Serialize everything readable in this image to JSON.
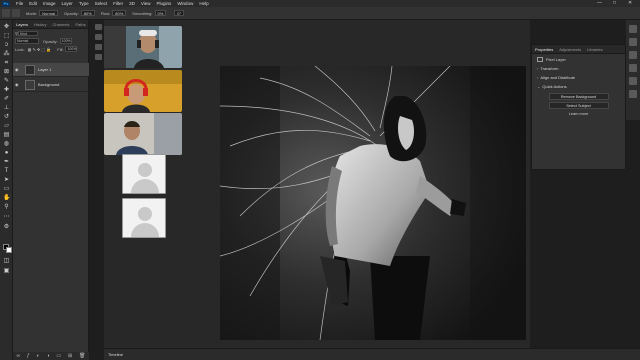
{
  "menubar": {
    "logo": "Ps",
    "items": [
      "File",
      "Edit",
      "Image",
      "Layer",
      "Type",
      "Select",
      "Filter",
      "3D",
      "View",
      "Plugins",
      "Window",
      "Help"
    ],
    "min": "—",
    "max": "□",
    "close": "✕"
  },
  "options": {
    "mode_label": "Mode:",
    "mode_value": "Normal",
    "opacity_label": "Opacity:",
    "opacity_value": "80%",
    "flow_label": "Flow:",
    "flow_value": "80%",
    "smoothing_label": "Smoothing:",
    "smoothing_value": "0%",
    "angle_value": "0°"
  },
  "layers": {
    "tabs": [
      "Layers",
      "History",
      "Channels",
      "Paths"
    ],
    "kind_label": "Kind",
    "blend_mode": "Normal",
    "opacity_label": "Opacity:",
    "opacity_value": "100%",
    "lock_label": "Lock:",
    "fill_label": "Fill:",
    "fill_value": "100%",
    "items": [
      {
        "name": "Layer 1",
        "selected": true
      },
      {
        "name": "Background",
        "selected": false
      }
    ]
  },
  "properties": {
    "tabs": [
      "Properties",
      "Adjustments",
      "Libraries"
    ],
    "pixel_layer_label": "Pixel Layer",
    "sections": [
      "Transform",
      "Align and Distribute",
      "Quick Actions"
    ],
    "buttons": [
      "Remove Background",
      "Select Subject"
    ],
    "link": "Learn more"
  },
  "timeline": {
    "label": "Timeline"
  },
  "colors": {
    "accent": "#31a8ff",
    "panel": "#323232",
    "app_bg": "#1e1e1e",
    "foreground": "#000000",
    "background": "#ffffff"
  }
}
